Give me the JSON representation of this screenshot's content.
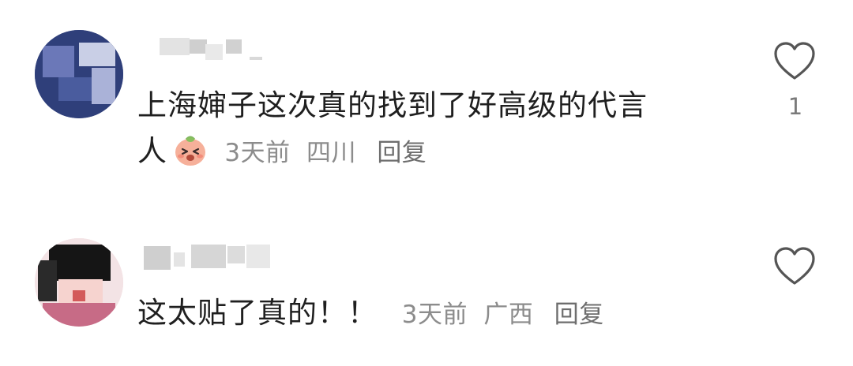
{
  "comments": [
    {
      "text_line1": "上海婶子这次真的找到了好高级的代言",
      "text_line2": "人",
      "emoji_icon": "blushing-peach-emoji-icon",
      "time": "3天前",
      "location": "四川",
      "reply_label": "回复",
      "like_count": "1"
    },
    {
      "text_line1": "这太贴了真的！！",
      "time": "3天前",
      "location": "广西",
      "reply_label": "回复"
    }
  ],
  "colors": {
    "text": "#1f1f1f",
    "meta": "#8c8c8c",
    "icon": "#555555"
  }
}
